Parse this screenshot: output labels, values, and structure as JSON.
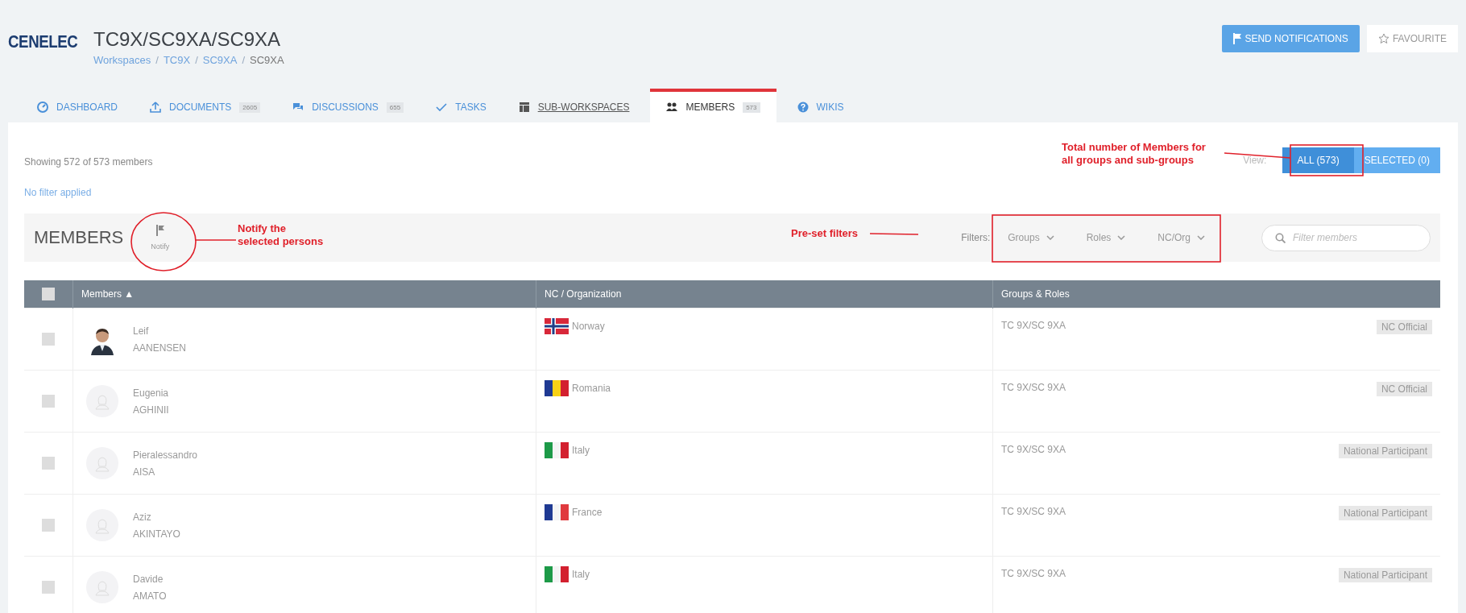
{
  "header": {
    "logo": "CENELEC",
    "title": "TC9X/SC9XA/SC9XA",
    "breadcrumb": [
      {
        "label": "Workspaces",
        "link": true,
        "separator": "/"
      },
      {
        "label": "TC9X",
        "link": true,
        "separator": "/"
      },
      {
        "label": "SC9XA",
        "link": true,
        "separator": "/"
      },
      {
        "label": "SC9XA",
        "link": false
      }
    ],
    "buttons": [
      {
        "label": "SEND NOTIFICATIONS",
        "kind": "primary"
      },
      {
        "label": "FAVOURITE",
        "kind": "plain"
      }
    ]
  },
  "tabs": [
    {
      "label": "DASHBOARD",
      "selected": false
    },
    {
      "label": "DOCUMENTS",
      "count": "2605",
      "selected": false
    },
    {
      "label": "DISCUSSIONS",
      "count": "655",
      "selected": false
    },
    {
      "label": "TASKS",
      "selected": false
    },
    {
      "label": "SUB-WORKSPACES",
      "selected": false
    },
    {
      "label": "MEMBERS",
      "count": "573",
      "selected": true
    },
    {
      "label": "WIKIS",
      "selected": false
    }
  ],
  "summary": {
    "showing": "Showing 572 of 573 members",
    "filter_status": "No filter applied"
  },
  "view": {
    "label": "View:",
    "options": [
      {
        "label": "ALL (573)",
        "selected": true
      },
      {
        "label": "SELECTED (0)",
        "selected": false
      }
    ]
  },
  "toolbar": {
    "title": "MEMBERS",
    "notify": "Notify",
    "filters_label": "Filters:",
    "filters": [
      "Groups",
      "Roles",
      "NC/Org"
    ],
    "search": {
      "placeholder": "Filter members"
    }
  },
  "table": {
    "select_all": {
      "checked": false
    },
    "columns": [
      {
        "label": "Members",
        "sort": "▲"
      },
      {
        "label": "NC / Organization"
      },
      {
        "label": "Groups & Roles"
      }
    ],
    "rows": [
      {
        "checked": false,
        "first": "Leif",
        "last": "AANENSEN",
        "country": "Norway",
        "group": "TC 9X/SC 9XA",
        "role": "NC Official"
      },
      {
        "checked": false,
        "kind": "placeholder",
        "first": "Eugenia",
        "last": "AGHINII",
        "country": "Romania",
        "group": "TC 9X/SC 9XA",
        "role": "NC Official"
      },
      {
        "checked": false,
        "kind": "placeholder",
        "first": "Pieralessandro",
        "last": "AISA",
        "country": "Italy",
        "group": "TC 9X/SC 9XA",
        "role": "National Participant"
      },
      {
        "checked": false,
        "kind": "placeholder",
        "first": "Aziz",
        "last": "AKINTAYO",
        "country": "France",
        "group": "TC 9X/SC 9XA",
        "role": "National Participant"
      },
      {
        "checked": false,
        "kind": "placeholder",
        "first": "Davide",
        "last": "AMATO",
        "country": "Italy",
        "group": "TC 9X/SC 9XA",
        "role": "National Participant"
      }
    ]
  },
  "annotations": [
    {
      "kind": "circle",
      "lines": [
        "Notify the",
        "selected persons"
      ]
    },
    {
      "kind": "box",
      "lines": [
        "Pre-set filters"
      ]
    },
    {
      "kind": "box",
      "lines": [
        "Total number of Members for",
        "all groups and sub-groups"
      ]
    }
  ]
}
